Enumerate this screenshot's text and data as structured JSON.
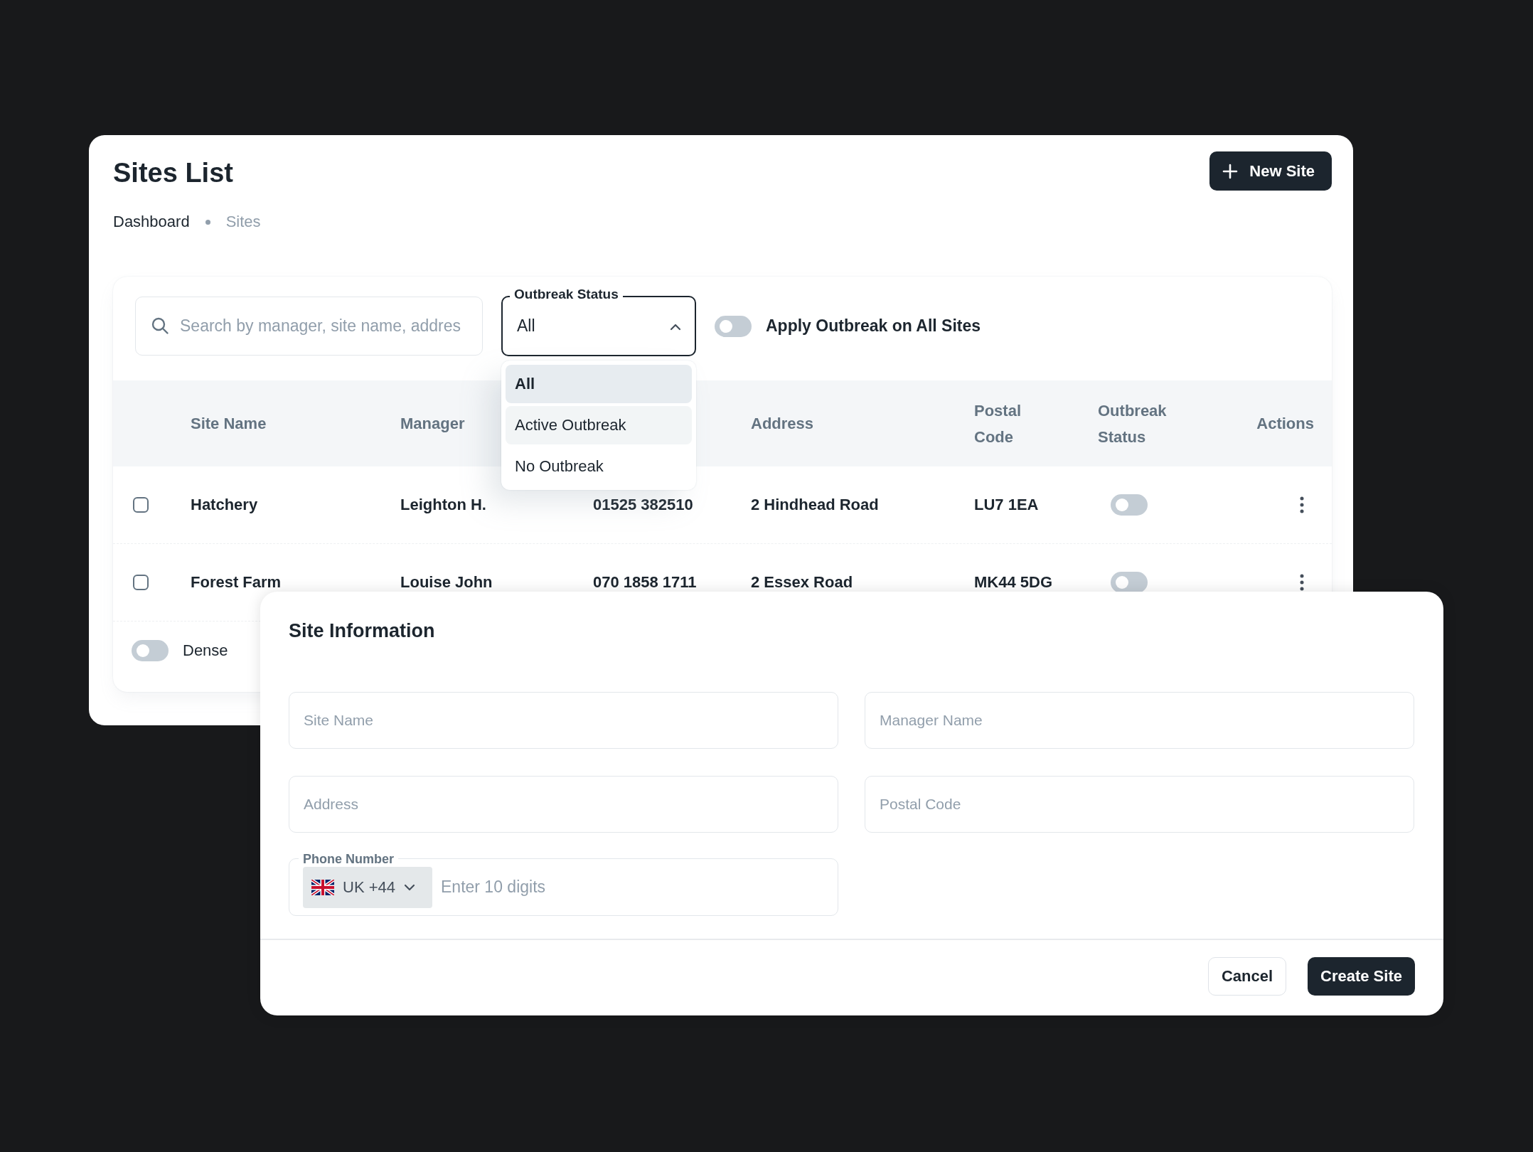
{
  "page": {
    "title": "Sites List",
    "new_button": {
      "label": "New Site"
    },
    "breadcrumbs": [
      {
        "label": "Dashboard",
        "current": false
      },
      {
        "label": "Sites",
        "current": true
      }
    ]
  },
  "filters": {
    "search": {
      "placeholder": "Search by manager, site name, addres"
    },
    "outbreak_status": {
      "label": "Outbreak Status",
      "value": "All",
      "expanded": true,
      "options": [
        {
          "label": "All",
          "selected": true,
          "hovered": false
        },
        {
          "label": "Active Outbreak",
          "selected": false,
          "hovered": true
        },
        {
          "label": "No Outbreak",
          "selected": false,
          "hovered": false
        }
      ]
    },
    "apply_all": {
      "label": "Apply Outbreak on All Sites",
      "on": false
    }
  },
  "table": {
    "columns": [
      "Site Name",
      "Manager",
      null,
      "Address",
      "Postal Code",
      "Outbreak Status",
      "Actions"
    ],
    "rows": [
      {
        "checked": false,
        "site_name": "Hatchery",
        "manager": "Leighton H.",
        "column_3": "01525 382510",
        "address": "2 Hindhead Road",
        "postal_code": "LU7 1EA",
        "outbreak_on": false
      },
      {
        "checked": false,
        "site_name": "Forest Farm",
        "manager": "Louise John",
        "column_3": "070 1858 1711",
        "address": "2 Essex Road",
        "postal_code": "MK44 5DG",
        "outbreak_on": false
      }
    ]
  },
  "dense": {
    "label": "Dense",
    "on": false
  },
  "dialog": {
    "title": "Site Information",
    "fields": [
      {
        "placeholder": "Site Name"
      },
      {
        "placeholder": "Manager Name"
      },
      {
        "placeholder": "Address"
      },
      {
        "placeholder": "Postal Code"
      }
    ],
    "phone": {
      "label": "Phone Number",
      "country": "UK +44",
      "placeholder": "Enter 10 digits"
    },
    "buttons": [
      {
        "label": "Cancel",
        "kind": "secondary"
      },
      {
        "label": "Create Site",
        "kind": "primary"
      }
    ]
  }
}
